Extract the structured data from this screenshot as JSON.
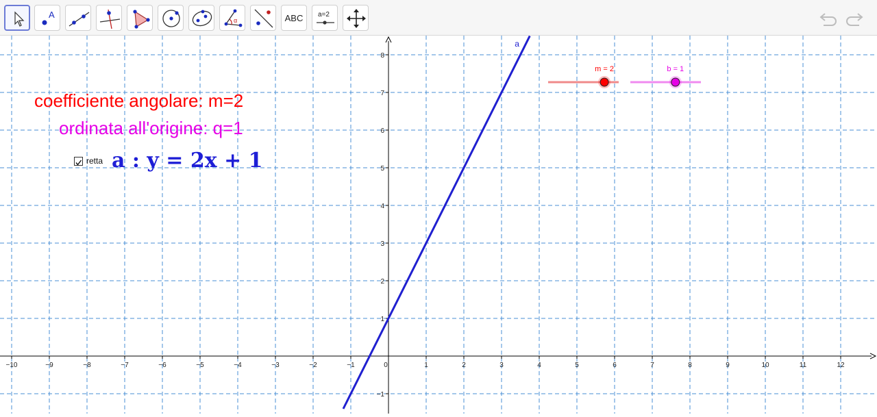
{
  "toolbar": {
    "tools": [
      {
        "name": "move",
        "icon": "cursor-arrow-icon",
        "selected": true
      },
      {
        "name": "point",
        "icon": "point-icon",
        "label": "A"
      },
      {
        "name": "line",
        "icon": "line-through-points-icon"
      },
      {
        "name": "perpendicular",
        "icon": "perpendicular-line-icon"
      },
      {
        "name": "polygon",
        "icon": "polygon-icon"
      },
      {
        "name": "circle",
        "icon": "circle-center-point-icon"
      },
      {
        "name": "ellipse",
        "icon": "ellipse-icon"
      },
      {
        "name": "angle",
        "icon": "angle-icon",
        "label": "α"
      },
      {
        "name": "reflect",
        "icon": "reflect-line-icon"
      },
      {
        "name": "text",
        "icon": "text-tool-icon",
        "label": "ABC"
      },
      {
        "name": "slider",
        "icon": "slider-tool-icon",
        "label": "a=2"
      },
      {
        "name": "move-view",
        "icon": "move-graphics-view-icon"
      }
    ],
    "undo_icon": "undo-icon",
    "redo_icon": "redo-icon"
  },
  "graphics": {
    "title_m": "coefficiente angolare: m=2",
    "title_q": "ordinata all'origine: q=1",
    "checkbox_label": "retta",
    "checkbox_checked": true,
    "equation": "a : y = 2x + 1",
    "line_label": "a",
    "colors": {
      "line": "#2020d0",
      "m_color": "#ff0000",
      "q_color": "#e600e6",
      "grid": "#4a8fd6",
      "axis": "#000000"
    }
  },
  "sliders": [
    {
      "label": "m = 2",
      "name": "m",
      "value": 2,
      "min": -5,
      "max": 5,
      "color": "#ff0000",
      "track_color": "#f08a8a"
    },
    {
      "label": "b = 1",
      "name": "b",
      "value": 1,
      "min": -5,
      "max": 5,
      "color": "#e600e6",
      "track_color": "#f08af0"
    }
  ],
  "chart_data": {
    "type": "line",
    "title": "",
    "xlabel": "",
    "ylabel": "",
    "xlim": [
      -10.5,
      12.9
    ],
    "ylim": [
      -1.4,
      8.5
    ],
    "grid": true,
    "x_ticks": [
      -10,
      -9,
      -8,
      -7,
      -6,
      -5,
      -4,
      -3,
      -2,
      -1,
      0,
      1,
      2,
      3,
      4,
      5,
      6,
      7,
      8,
      9,
      10,
      11,
      12
    ],
    "x_tick_labels": [
      "−10",
      "−9",
      "−8",
      "−7",
      "−6",
      "−5",
      "−4",
      "−3",
      "−2",
      "−1",
      "0",
      "1",
      "2",
      "3",
      "4",
      "5",
      "6",
      "7",
      "8",
      "9",
      "10",
      "11",
      "12"
    ],
    "y_ticks": [
      -1,
      1,
      2,
      3,
      4,
      5,
      6,
      7,
      8
    ],
    "y_tick_labels": [
      "−1",
      "1",
      "2",
      "3",
      "4",
      "5",
      "6",
      "7",
      "8"
    ],
    "series": [
      {
        "name": "a",
        "slope": 2,
        "intercept": 1,
        "x": [
          -1.2,
          3.75
        ],
        "y": [
          -1.4,
          8.5
        ]
      }
    ]
  }
}
